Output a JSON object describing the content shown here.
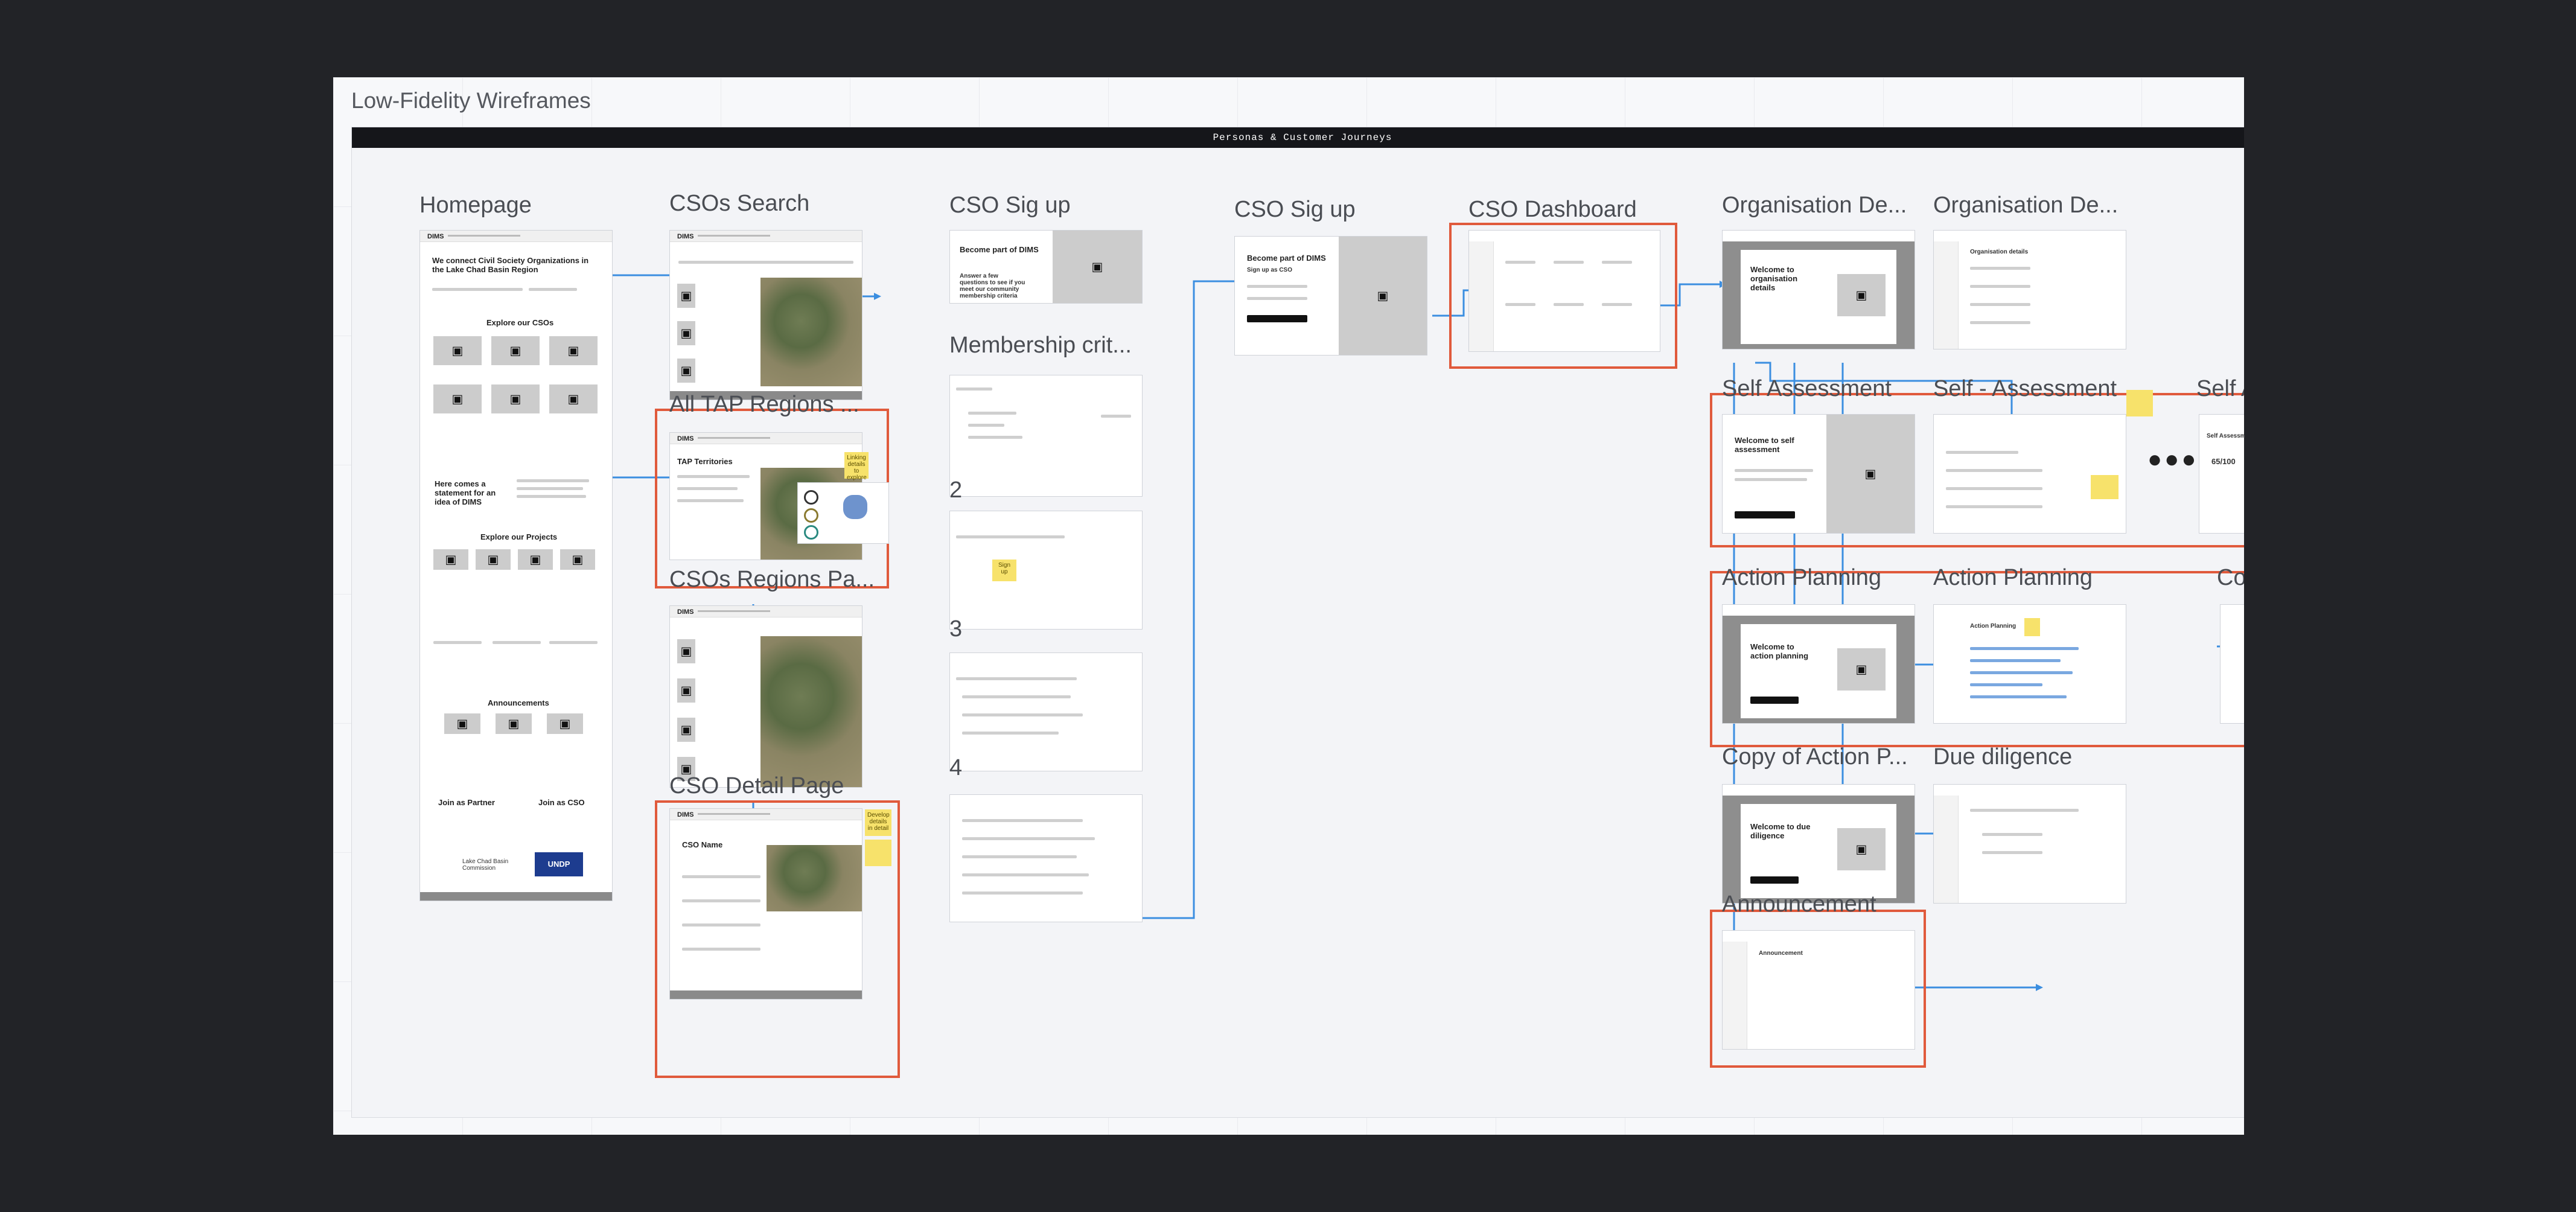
{
  "board": {
    "title": "Low-Fidelity Wireframes",
    "banner": "Personas & Customer Journeys"
  },
  "labels": {
    "homepage": "Homepage",
    "cso_search": "CSOs Search",
    "cso_signup_a": "CSO Sig up",
    "membership": "Membership crit...",
    "cso_signup_b": "CSO Sig up",
    "cso_dashboard": "CSO Dashboard",
    "org_details_a": "Organisation De...",
    "org_details_b": "Organisation De...",
    "tap_regions": "All TAP Regions ...",
    "cso_regions": "CSOs Regions Pa...",
    "cso_detail": "CSO Detail Page",
    "self_assessment": "Self Assessment",
    "self_assessment_b": "Self - Assessment",
    "self_assessment_c": "Self A",
    "action_planning": "Action Planning",
    "action_planning_b": "Action Planning",
    "copy_action_a": "Copy of Ac",
    "copy_action_b": "Copy of Action P...",
    "due_diligence": "Due diligence",
    "announcement": "Announcement",
    "step_2": "2",
    "step_3": "3",
    "step_4": "4"
  },
  "homepage": {
    "logo": "DIMS",
    "hero": "We connect Civil Society Organizations in the Lake Chad Basin Region",
    "explore_csos": "Explore our CSOs",
    "about": "Here comes a statement for an idea of DIMS",
    "explore_projects": "Explore our Projects",
    "announcements": "Announcements",
    "join_partner": "Join as Partner",
    "join_cso": "Join as CSO",
    "partner_a": "Lake Chad Basin Commission",
    "partner_b": "UNDP"
  },
  "frames": {
    "dims_logo": "DIMS",
    "tap_territories": "TAP Territories",
    "signup_heading": "Become part of DIMS",
    "signup_text": "Answer a few questions to see if you meet our community membership criteria",
    "signup_b_heading": "Become part of DIMS",
    "signup_b_sub": "Sign up as CSO",
    "cso_name": "CSO Name",
    "welcome_org": "Welcome to organisation details",
    "org_details": "Organisation details",
    "welcome_self": "Welcome to self assessment",
    "welcome_action": "Welcome to action planning",
    "action_planning_title": "Action Planning",
    "welcome_due": "Welcome to due diligence",
    "announcement_title": "Announcement",
    "score": "65/100",
    "self_assessment_title": "Self Assessment"
  },
  "stickies": {
    "tap": "Linking details to explore",
    "detail_a": "Develop details in detail",
    "membership": "Sign up"
  }
}
